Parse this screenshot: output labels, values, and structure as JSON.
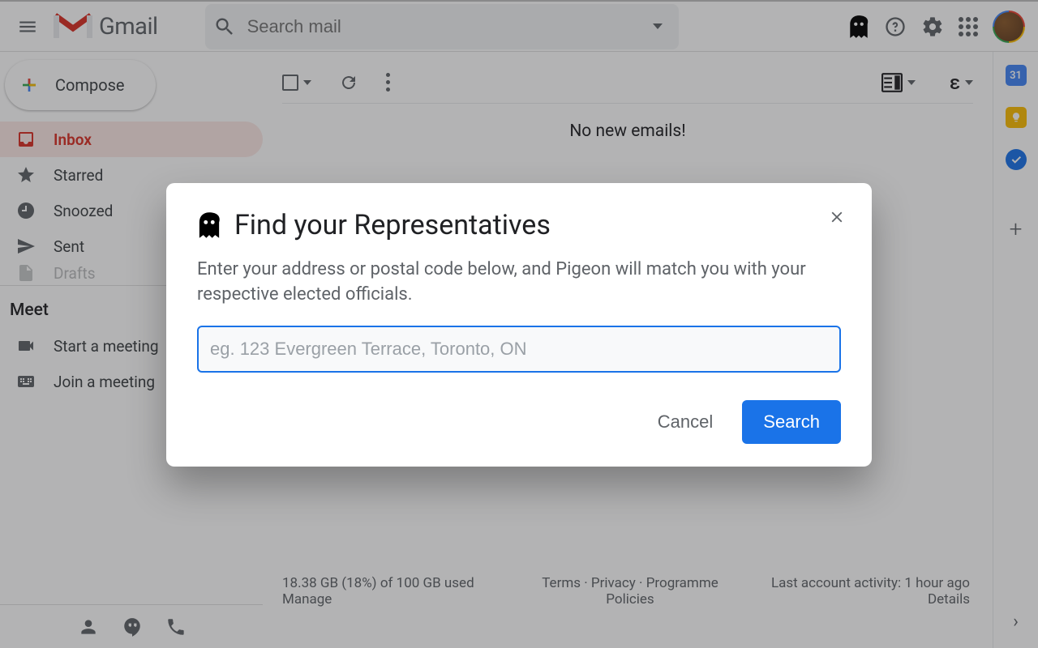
{
  "header": {
    "app_name": "Gmail",
    "search_placeholder": "Search mail"
  },
  "compose_label": "Compose",
  "sidebar": {
    "items": [
      {
        "label": "Inbox",
        "icon": "inbox-icon",
        "active": true
      },
      {
        "label": "Starred",
        "icon": "star-icon",
        "active": false
      },
      {
        "label": "Snoozed",
        "icon": "clock-icon",
        "active": false
      },
      {
        "label": "Sent",
        "icon": "send-icon",
        "active": false
      },
      {
        "label": "Drafts",
        "icon": "draft-icon",
        "active": false
      }
    ],
    "meet_header": "Meet",
    "meet_items": [
      {
        "label": "Start a meeting",
        "icon": "video-icon"
      },
      {
        "label": "Join a meeting",
        "icon": "keyboard-icon"
      }
    ]
  },
  "toolbar": {
    "split_caret": "▾",
    "input_tools_glyph": "ε"
  },
  "empty_message": "No new emails!",
  "footer": {
    "storage_line": "18.38 GB (18%) of 100 GB used",
    "manage": "Manage",
    "terms": "Terms",
    "privacy": "Privacy",
    "policies": "Programme Policies",
    "activity_line": "Last account activity: 1 hour ago",
    "details": "Details"
  },
  "rightrail": {
    "calendar_day": "31"
  },
  "dialog": {
    "title": "Find your Representatives",
    "description": "Enter your address or postal code below, and Pigeon will match you with your respective elected officials.",
    "placeholder": "eg. 123 Evergreen Terrace, Toronto, ON",
    "cancel": "Cancel",
    "search": "Search"
  }
}
